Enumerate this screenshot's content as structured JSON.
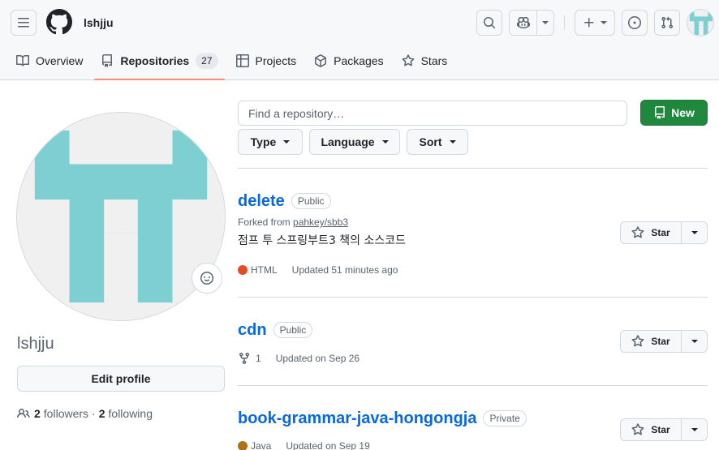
{
  "header": {
    "username": "lshjju"
  },
  "tabs": [
    {
      "label": "Overview",
      "icon": "book-icon"
    },
    {
      "label": "Repositories",
      "icon": "repo-icon",
      "count": "27",
      "selected": true
    },
    {
      "label": "Projects",
      "icon": "table-icon"
    },
    {
      "label": "Packages",
      "icon": "package-icon"
    },
    {
      "label": "Stars",
      "icon": "star-icon"
    }
  ],
  "profile": {
    "name": "lshjju",
    "edit_label": "Edit profile",
    "followers_count": "2",
    "followers_label": "followers",
    "separator": "·",
    "following_count": "2",
    "following_label": "following",
    "avatar_color": "#7ecfd1"
  },
  "toolbar": {
    "search_placeholder": "Find a repository…",
    "new_label": "New",
    "filters": [
      "Type",
      "Language",
      "Sort"
    ]
  },
  "repos": [
    {
      "name": "delete",
      "visibility": "Public",
      "forked_prefix": "Forked from",
      "forked_from": "pahkey/sbb3",
      "description": "점프 투 스프링부트3 책의 소스코드",
      "language": "HTML",
      "language_color": "#e34c26",
      "updated": "Updated 51 minutes ago",
      "star_label": "Star"
    },
    {
      "name": "cdn",
      "visibility": "Public",
      "forks": "1",
      "updated": "Updated on Sep 26",
      "star_label": "Star"
    },
    {
      "name": "book-grammar-java-hongongja",
      "visibility": "Private",
      "language": "Java",
      "language_color": "#b07219",
      "updated": "Updated on Sep 19",
      "star_label": "Star"
    }
  ]
}
